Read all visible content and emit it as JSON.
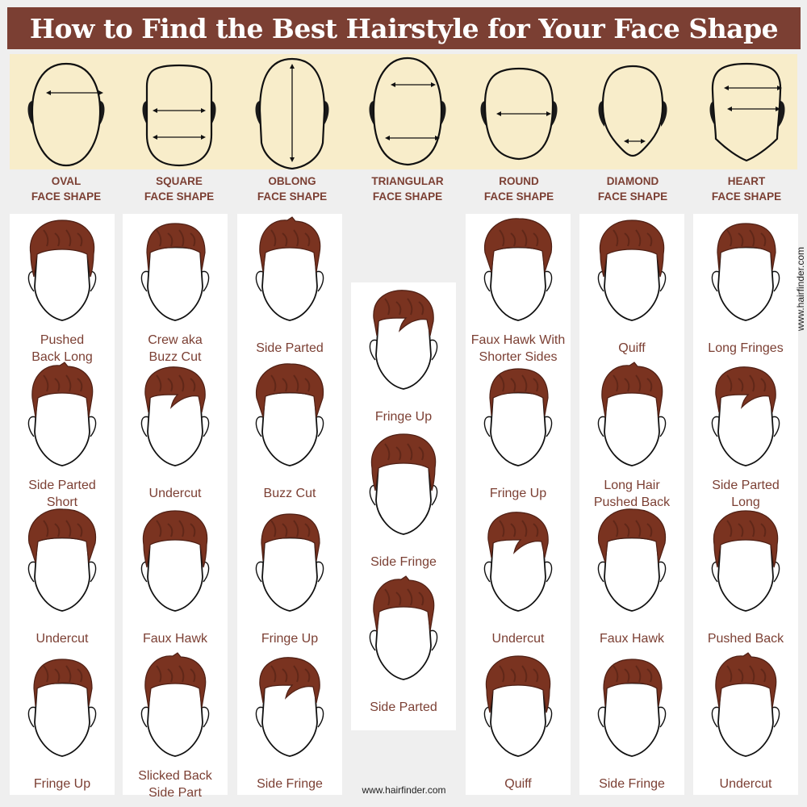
{
  "title": "How to Find the Best Hairstyle for Your Face Shape",
  "colors": {
    "brand": "#7b3f33",
    "band": "#f8edca",
    "hair": "#7a3320",
    "hair_dark": "#4e1f14",
    "background": "#efefef"
  },
  "face_shapes": [
    {
      "name": "OVAL",
      "suffix": "FACE SHAPE"
    },
    {
      "name": "SQUARE",
      "suffix": "FACE SHAPE"
    },
    {
      "name": "OBLONG",
      "suffix": "FACE SHAPE"
    },
    {
      "name": "TRIANGULAR",
      "suffix": "FACE SHAPE"
    },
    {
      "name": "ROUND",
      "suffix": "FACE SHAPE"
    },
    {
      "name": "DIAMOND",
      "suffix": "FACE SHAPE"
    },
    {
      "name": "HEART",
      "suffix": "FACE SHAPE"
    }
  ],
  "columns": [
    {
      "face": "OVAL",
      "styles": [
        {
          "line1": "Pushed",
          "line2": "Back Long"
        },
        {
          "line1": "Side Parted",
          "line2": "Short"
        },
        {
          "line1": "Undercut",
          "line2": ""
        },
        {
          "line1": "Fringe Up",
          "line2": ""
        }
      ]
    },
    {
      "face": "SQUARE",
      "styles": [
        {
          "line1": "Crew aka",
          "line2": "Buzz Cut"
        },
        {
          "line1": "Undercut",
          "line2": ""
        },
        {
          "line1": "Faux Hawk",
          "line2": ""
        },
        {
          "line1": "Slicked Back",
          "line2": "Side Part"
        }
      ]
    },
    {
      "face": "OBLONG",
      "styles": [
        {
          "line1": "Side Parted",
          "line2": ""
        },
        {
          "line1": "Buzz Cut",
          "line2": ""
        },
        {
          "line1": "Fringe Up",
          "line2": ""
        },
        {
          "line1": "Side Fringe",
          "line2": ""
        }
      ]
    },
    {
      "face": "TRIANGULAR",
      "styles": [
        {
          "line1": "Fringe Up",
          "line2": ""
        },
        {
          "line1": "Side Fringe",
          "line2": ""
        },
        {
          "line1": "Side Parted",
          "line2": ""
        }
      ]
    },
    {
      "face": "ROUND",
      "styles": [
        {
          "line1": "Faux Hawk With",
          "line2": "Shorter Sides"
        },
        {
          "line1": "Fringe Up",
          "line2": ""
        },
        {
          "line1": "Undercut",
          "line2": ""
        },
        {
          "line1": "Quiff",
          "line2": ""
        }
      ]
    },
    {
      "face": "DIAMOND",
      "styles": [
        {
          "line1": "Quiff",
          "line2": ""
        },
        {
          "line1": "Long Hair",
          "line2": "Pushed Back"
        },
        {
          "line1": "Faux Hawk",
          "line2": ""
        },
        {
          "line1": "Side Fringe",
          "line2": ""
        }
      ]
    },
    {
      "face": "HEART",
      "styles": [
        {
          "line1": "Long Fringes",
          "line2": ""
        },
        {
          "line1": "Side Parted",
          "line2": "Long"
        },
        {
          "line1": "Pushed Back",
          "line2": ""
        },
        {
          "line1": "Undercut",
          "line2": ""
        }
      ]
    }
  ],
  "watermark": "www.hairfinder.com"
}
